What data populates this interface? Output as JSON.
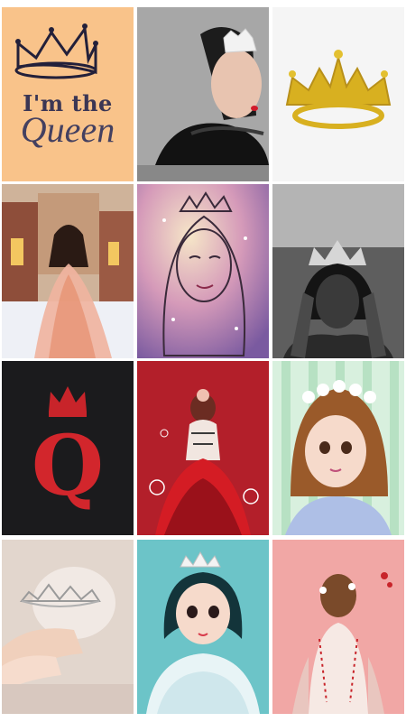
{
  "gallery": {
    "tiles": [
      {
        "id": "im-the-queen-text",
        "line1": "I'm the",
        "line2": "Queen"
      },
      {
        "id": "girl-with-tiara"
      },
      {
        "id": "gold-glitter-crown"
      },
      {
        "id": "bride-castle-back"
      },
      {
        "id": "sparkle-queen-sketch"
      },
      {
        "id": "bw-woman-crown"
      },
      {
        "id": "red-q-crown",
        "letter": "Q"
      },
      {
        "id": "red-gown-girl"
      },
      {
        "id": "flower-crown-girl"
      },
      {
        "id": "hands-tiara"
      },
      {
        "id": "crowned-girl-fur"
      },
      {
        "id": "bride-back-pink"
      }
    ]
  },
  "colors": {
    "peach": "#f9c38a",
    "crimson": "#b3202a",
    "mint": "#c9ead2",
    "teal": "#6fc5c9",
    "pink": "#f2a6a3"
  }
}
